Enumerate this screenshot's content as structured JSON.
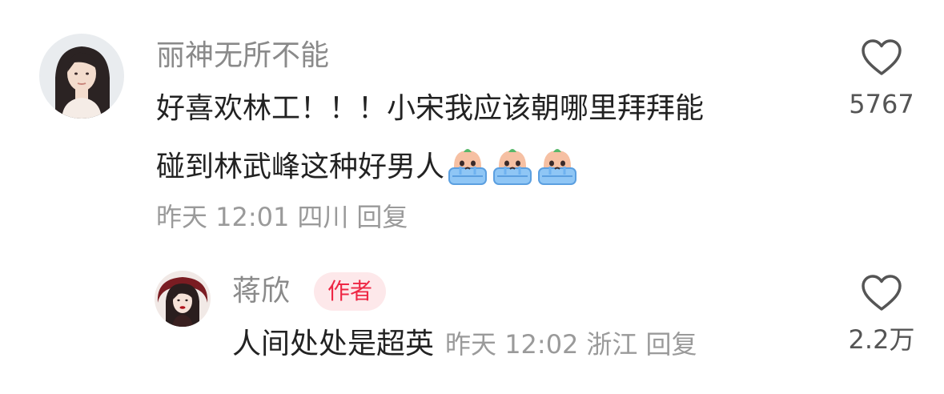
{
  "comments": [
    {
      "username": "丽神无所不能",
      "text_line1": "好喜欢林工！！！小宋我应该朝哪里拜拜能",
      "text_line2": "碰到林武峰这种好男人",
      "emojis": [
        "crying-face-emoji",
        "crying-face-emoji",
        "crying-face-emoji"
      ],
      "time": "昨天 12:01",
      "location": "四川",
      "reply_label": "回复",
      "like_count": "5767"
    },
    {
      "username": "蒋欣",
      "author_badge": "作者",
      "text": "人间处处是超英",
      "time": "昨天 12:02",
      "location": "浙江",
      "reply_label": "回复",
      "like_count": "2.2万"
    }
  ],
  "colors": {
    "username": "#8a8a8a",
    "meta": "#9a9a9a",
    "badge_bg": "#fde8ea",
    "badge_text": "#ee2744"
  }
}
